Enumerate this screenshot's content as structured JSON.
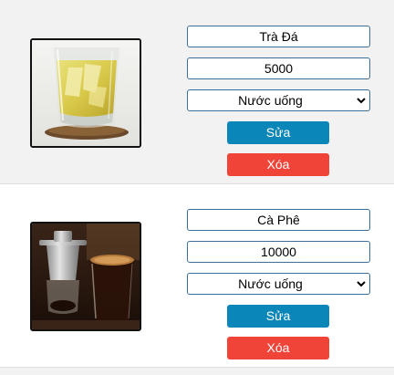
{
  "products": [
    {
      "name": "Trà Đá",
      "price": "5000",
      "category": "Nước uống",
      "image": "iced-tea-glass-image",
      "edit_label": "Sửa",
      "delete_label": "Xóa"
    },
    {
      "name": "Cà Phê",
      "price": "10000",
      "category": "Nước uống",
      "image": "vietnamese-coffee-image",
      "edit_label": "Sửa",
      "delete_label": "Xóa"
    }
  ],
  "colors": {
    "edit_button": "#0a86b8",
    "delete_button": "#f04438",
    "input_border": "#3b6f99",
    "row_alt": "#f2f2f2"
  }
}
